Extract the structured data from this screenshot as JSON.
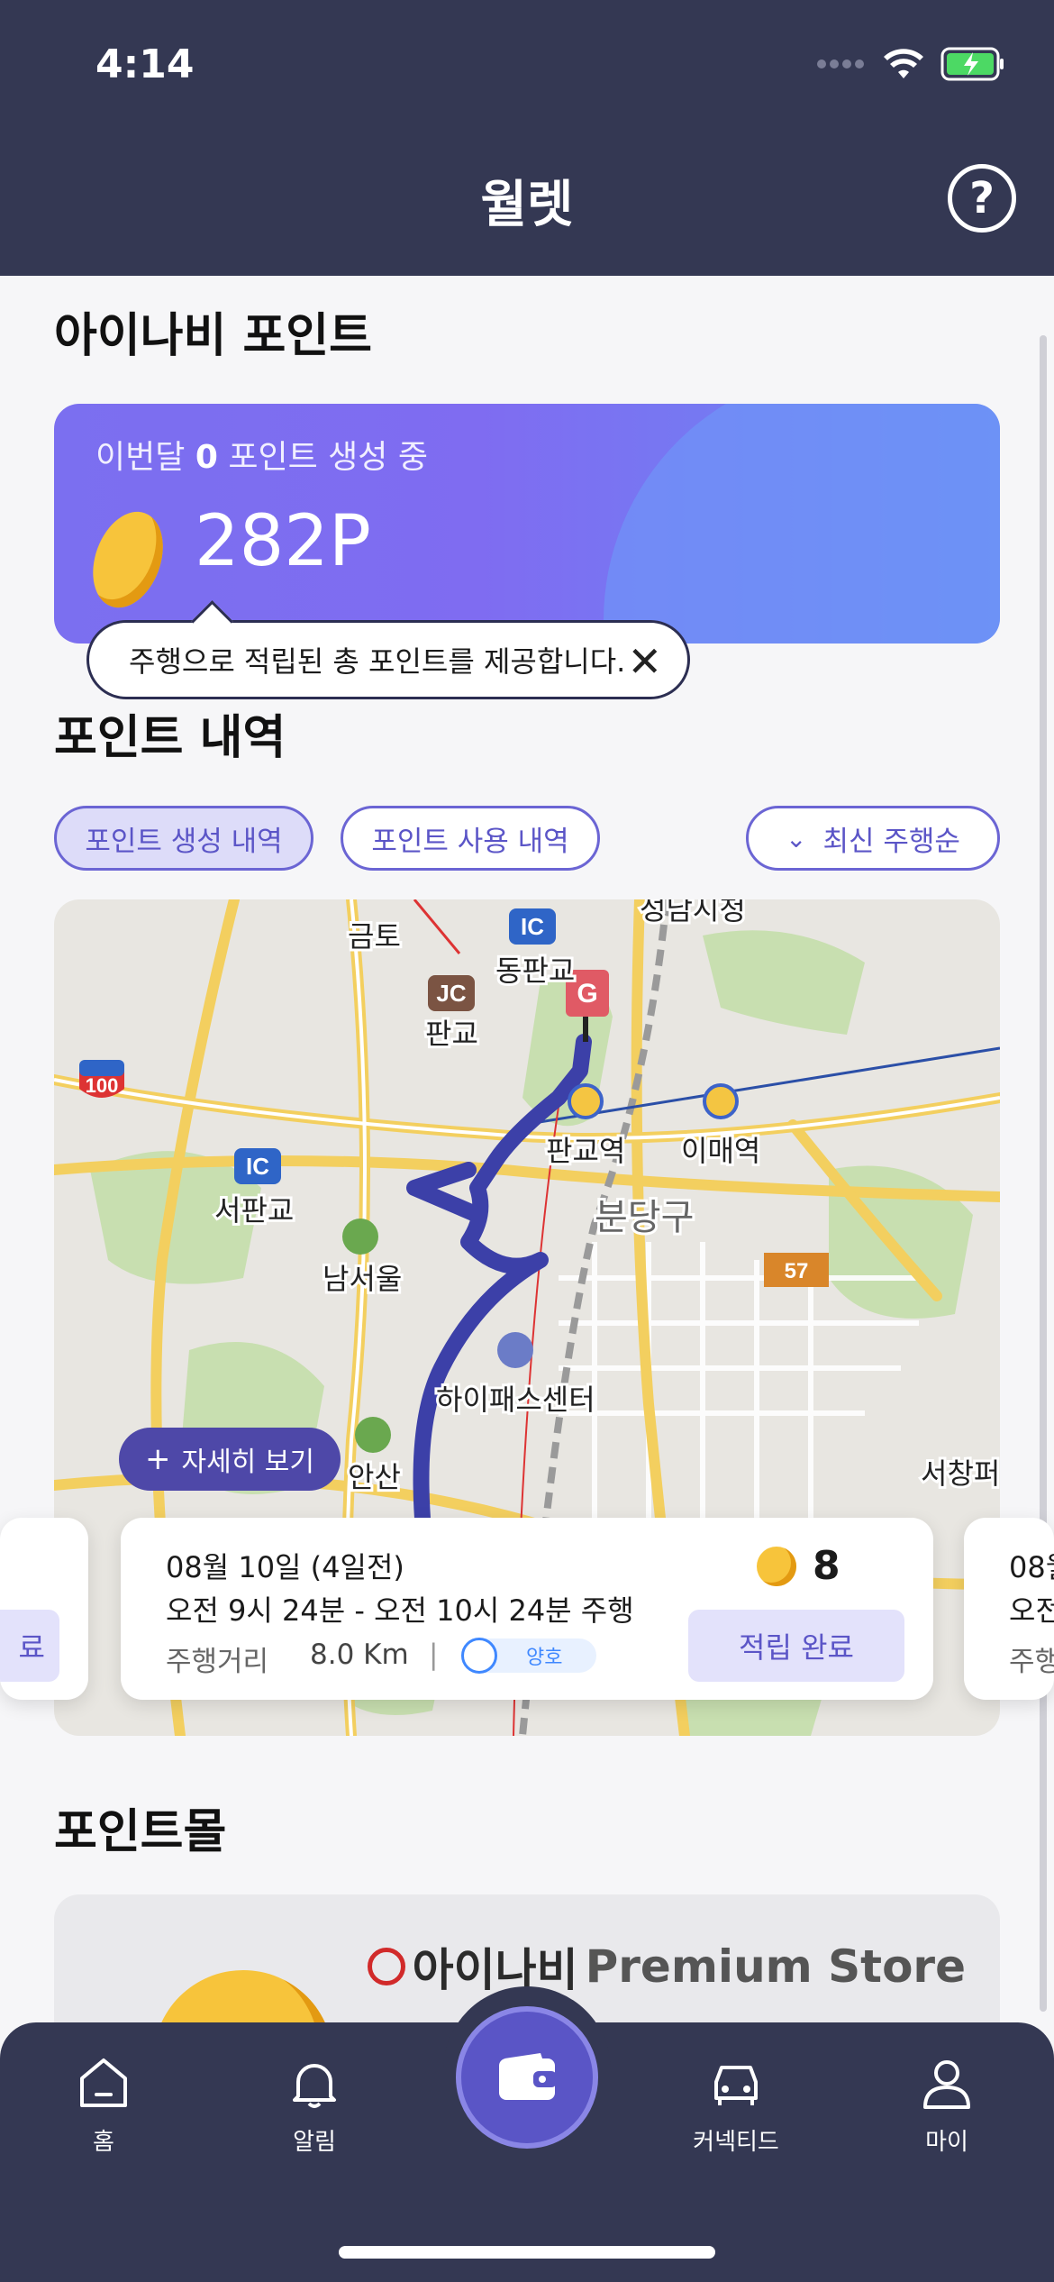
{
  "status_bar": {
    "time": "4:14"
  },
  "header": {
    "title": "월렛",
    "help_icon": "help-icon"
  },
  "points_section": {
    "title": "아이나비 포인트",
    "card": {
      "subtitle_prefix": "이번달",
      "subtitle_count": "0",
      "subtitle_suffix": "포인트 생성 중",
      "total": "282P"
    },
    "tooltip": "주행으로 적립된 총 포인트를 제공합니다."
  },
  "history_section": {
    "title": "포인트 내역",
    "filters": [
      "포인트 생성 내역",
      "포인트 사용 내역"
    ],
    "sort_label": "최신 주행순",
    "map": {
      "labels": [
        "금토",
        "동판교",
        "판교",
        "성남시청",
        "판교역",
        "이매역",
        "서판교",
        "남서울",
        "분당구",
        "하이패스센터",
        "안산",
        "서창퍼",
        "100",
        "57",
        "IC",
        "JC",
        "G"
      ]
    },
    "detail_button": "자세히 보기",
    "trip": {
      "date": "08월 10일 (4일전)",
      "time": "오전 9시 24분 - 오전 10시 24분 주행",
      "distance_label": "주행거리",
      "distance_value": "8.0 Km",
      "separator": "|",
      "rating": "양호",
      "points": "8",
      "status": "적립 완료"
    },
    "peek_next": {
      "date": "08월",
      "time": "오전",
      "distance": "주행"
    },
    "peek_prev": {
      "button": "료"
    }
  },
  "mall_section": {
    "title": "포인트몰",
    "banner": {
      "brand": "아이나비",
      "store": "Premium Store"
    }
  },
  "bottom_nav": {
    "items": [
      {
        "label": "홈",
        "icon": "home-icon"
      },
      {
        "label": "알림",
        "icon": "bell-icon"
      },
      {
        "label": "",
        "icon": "wallet-icon"
      },
      {
        "label": "커넥티드",
        "icon": "car-icon"
      },
      {
        "label": "마이",
        "icon": "user-icon"
      }
    ]
  },
  "colors": {
    "header_bg": "#343853",
    "accent": "#5b55c7",
    "card_start": "#7b6ff0",
    "card_end": "#6a89f4",
    "route": "#3c40a8"
  }
}
